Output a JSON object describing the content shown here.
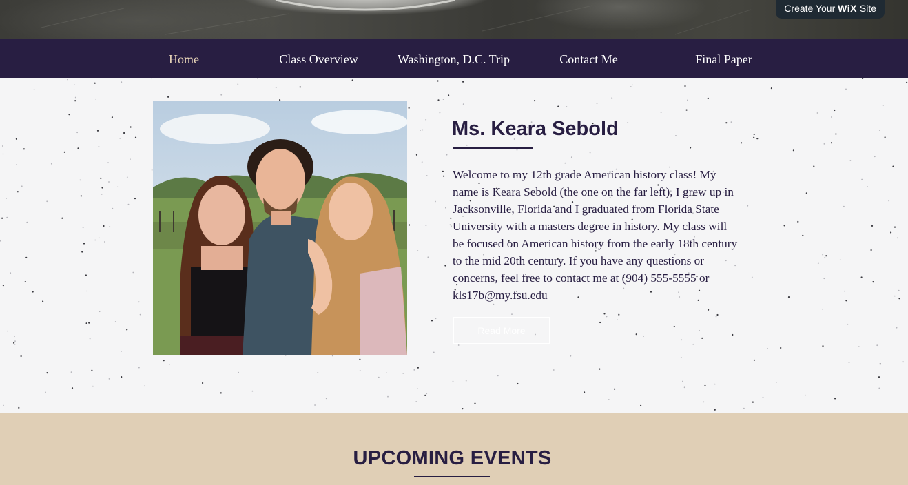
{
  "header": {
    "wix_badge_prefix": "Create Your ",
    "wix_badge_brand": "WiX",
    "wix_badge_suffix": " Site"
  },
  "nav": {
    "items": [
      {
        "label": "Home",
        "active": true
      },
      {
        "label": "Class Overview",
        "active": false
      },
      {
        "label": "Washington, D.C. Trip",
        "active": false
      },
      {
        "label": "Contact Me",
        "active": false
      },
      {
        "label": "Final Paper",
        "active": false
      }
    ]
  },
  "about": {
    "name": "Ms. Keara Sebold",
    "bio": "Welcome to my 12th grade American history class! My name is Keara Sebold (the one on the far left), I grew up in Jacksonville, Florida and I graduated from Florida State University with a masters degree in history. My class will be focused on American history from the early 18th century to the mid 20th century. If you have any questions or concerns, feel free to contact me at (904) 555-5555 or kls17b@my.fsu.edu",
    "read_more_label": "Read More",
    "photo_icon": "group-photo"
  },
  "events": {
    "title": "UPCOMING EVENTS"
  },
  "colors": {
    "nav_bg": "#281e42",
    "nav_active": "#e6d3b7",
    "events_bg": "#e0cfb6",
    "text_dark": "#281e42"
  }
}
